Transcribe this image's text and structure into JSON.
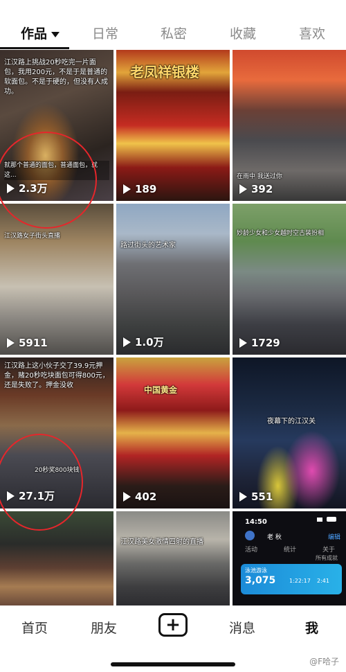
{
  "tabs": [
    {
      "label": "作品",
      "active": true
    },
    {
      "label": "日常"
    },
    {
      "label": "私密"
    },
    {
      "label": "收藏"
    },
    {
      "label": "喜欢"
    }
  ],
  "videos": [
    {
      "views": "2.3万",
      "caption": "江汉路上挑战20秒吃完一片面包，我用200元，不是于是普通的软面包。不是于硬的，但没有人成功。",
      "caption2": "就那个普通的面包，普通面包，就这..."
    },
    {
      "views": "189",
      "caption": "老凤祥银楼"
    },
    {
      "views": "392",
      "caption": "在雨中 我送过你"
    },
    {
      "views": "5911",
      "caption": "江汉路女子街头直播"
    },
    {
      "views": "1.0万",
      "caption": "路过街头的艺术家"
    },
    {
      "views": "1729",
      "caption": "妙龄少女和少女越时空古装扮相"
    },
    {
      "views": "27.1万",
      "caption": "江汉路上这小伙子交了39.9元押金，赌20秒吃块面包可得800元，还是失败了。押金没收",
      "caption2": "20秒奖800块钱"
    },
    {
      "views": "402",
      "caption": "中国黄金"
    },
    {
      "views": "551",
      "caption": "夜幕下的江汉关"
    },
    {
      "views": "",
      "caption": ""
    },
    {
      "views": "",
      "caption": "江汉路美女激情四射的直播"
    },
    {
      "views": "",
      "caption": "",
      "phone": {
        "time": "14:50",
        "name": "老 秋",
        "tab1": "活动",
        "tab2": "统计",
        "tab3": "关于",
        "link": "所有成就",
        "value": "3,075",
        "t1": "1:22:17",
        "t2": "2:41",
        "label": "泳池游泳",
        "edit": "编辑"
      }
    }
  ],
  "nav": [
    {
      "label": "首页"
    },
    {
      "label": "朋友"
    },
    {
      "label": "+"
    },
    {
      "label": "消息"
    },
    {
      "label": "我",
      "active": true
    }
  ],
  "watermark": "@F哈子",
  "colors": {
    "highlight_circle": "#e6262b"
  }
}
